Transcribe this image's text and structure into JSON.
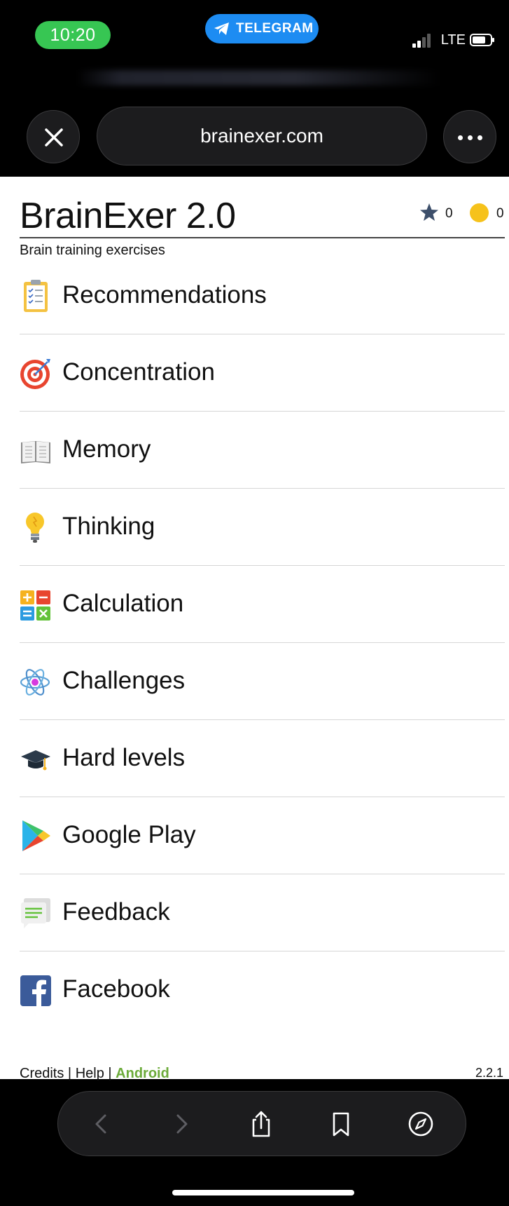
{
  "status_bar": {
    "time": "10:20",
    "back_app": "TELEGRAM",
    "network": "LTE",
    "time_pill_color": "#37c653",
    "telegram_color": "#1d8cf2"
  },
  "browser": {
    "url": "brainexer.com",
    "close_icon": "close-icon",
    "more_icon": "ellipsis-icon"
  },
  "site": {
    "title": "BrainExer 2.0",
    "subtitle": "Brain training exercises",
    "stars_count": "0",
    "coins_count": "0"
  },
  "menu": [
    {
      "label": "Recommendations",
      "icon": "clipboard-checklist-icon"
    },
    {
      "label": "Concentration",
      "icon": "target-icon"
    },
    {
      "label": "Memory",
      "icon": "open-book-icon"
    },
    {
      "label": "Thinking",
      "icon": "light-bulb-icon"
    },
    {
      "label": "Calculation",
      "icon": "math-operators-icon"
    },
    {
      "label": "Challenges",
      "icon": "atom-icon"
    },
    {
      "label": "Hard levels",
      "icon": "graduation-cap-icon"
    },
    {
      "label": "Google Play",
      "icon": "google-play-icon"
    },
    {
      "label": "Feedback",
      "icon": "speech-bubble-icon"
    },
    {
      "label": "Facebook",
      "icon": "facebook-icon"
    }
  ],
  "footer": {
    "credits": "Credits",
    "help": "Help",
    "android": "Android",
    "separator": "|",
    "version": "2.2.1",
    "android_color": "#6cab3a"
  },
  "toolbar": {
    "items": [
      "back-icon",
      "forward-icon",
      "share-icon",
      "bookmarks-icon",
      "compass-icon"
    ]
  }
}
